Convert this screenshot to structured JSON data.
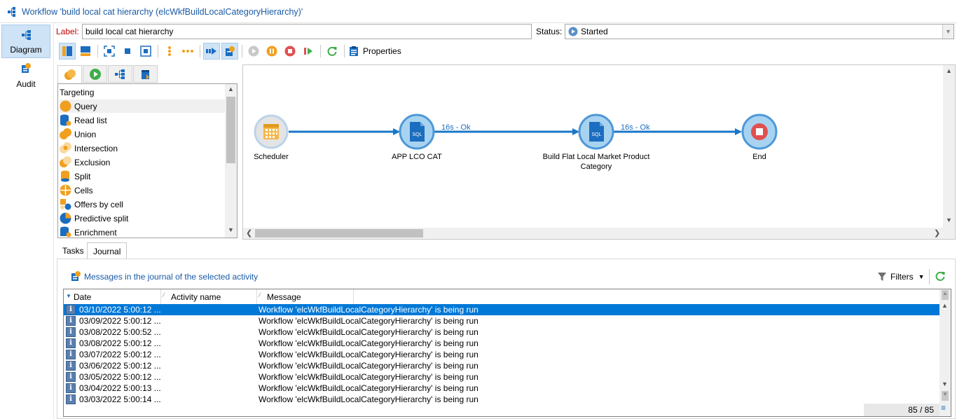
{
  "window": {
    "title": "Workflow 'build local cat  hierarchy (elcWkfBuildLocalCategoryHierarchy)'"
  },
  "nav": {
    "items": [
      {
        "label": "Diagram",
        "icon": "diagram-icon",
        "active": true
      },
      {
        "label": "Audit",
        "icon": "audit-icon",
        "active": false
      }
    ]
  },
  "form": {
    "label_caption": "Label:",
    "label_value": "build local cat  hierarchy",
    "status_caption": "Status:",
    "status_value": "Started"
  },
  "toolbar": {
    "properties_label": "Properties"
  },
  "palette": {
    "tabs": [
      "targeting-tab-icon",
      "flow-control-tab-icon",
      "actions-tab-icon",
      "events-tab-icon"
    ],
    "items": [
      {
        "label": "Targeting",
        "header": true
      },
      {
        "label": "Query",
        "icon": "query-icon"
      },
      {
        "label": "Read list",
        "icon": "read-list-icon"
      },
      {
        "label": "Union",
        "icon": "union-icon"
      },
      {
        "label": "Intersection",
        "icon": "intersection-icon"
      },
      {
        "label": "Exclusion",
        "icon": "exclusion-icon"
      },
      {
        "label": "Split",
        "icon": "split-icon"
      },
      {
        "label": "Cells",
        "icon": "cells-icon"
      },
      {
        "label": "Offers by cell",
        "icon": "offers-by-cell-icon"
      },
      {
        "label": "Predictive split",
        "icon": "predictive-split-icon"
      },
      {
        "label": "Enrichment",
        "icon": "enrichment-icon"
      }
    ]
  },
  "diagram": {
    "nodes": [
      {
        "label": "Scheduler",
        "icon": "calendar-icon"
      },
      {
        "label": "APP LCO CAT",
        "icon": "sql-icon"
      },
      {
        "label": "Build Flat Local Market Product Category",
        "icon": "sql-icon"
      },
      {
        "label": "End",
        "icon": "stop-icon"
      }
    ],
    "transitions": [
      {
        "label": ""
      },
      {
        "label": "16s - Ok"
      },
      {
        "label": "16s - Ok"
      }
    ]
  },
  "bottom_tabs": [
    "Tasks",
    "Journal"
  ],
  "journal": {
    "header_text": "Messages in the journal of the selected activity",
    "filters_label": "Filters",
    "columns": [
      "Date",
      "Activity name",
      "Message"
    ],
    "rows": [
      {
        "date": "03/10/2022 5:00:12 ...",
        "activity": "",
        "message": "Workflow 'elcWkfBuildLocalCategoryHierarchy' is being run"
      },
      {
        "date": "03/09/2022 5:00:12 ...",
        "activity": "",
        "message": "Workflow 'elcWkfBuildLocalCategoryHierarchy' is being run"
      },
      {
        "date": "03/08/2022 5:00:52 ...",
        "activity": "",
        "message": "Workflow 'elcWkfBuildLocalCategoryHierarchy' is being run"
      },
      {
        "date": "03/08/2022 5:00:12 ...",
        "activity": "",
        "message": "Workflow 'elcWkfBuildLocalCategoryHierarchy' is being run"
      },
      {
        "date": "03/07/2022 5:00:12 ...",
        "activity": "",
        "message": "Workflow 'elcWkfBuildLocalCategoryHierarchy' is being run"
      },
      {
        "date": "03/06/2022 5:00:12 ...",
        "activity": "",
        "message": "Workflow 'elcWkfBuildLocalCategoryHierarchy' is being run"
      },
      {
        "date": "03/05/2022 5:00:12 ...",
        "activity": "",
        "message": "Workflow 'elcWkfBuildLocalCategoryHierarchy' is being run"
      },
      {
        "date": "03/04/2022 5:00:13 ...",
        "activity": "",
        "message": "Workflow 'elcWkfBuildLocalCategoryHierarchy' is being run"
      },
      {
        "date": "03/03/2022 5:00:14 ...",
        "activity": "",
        "message": "Workflow 'elcWkfBuildLocalCategoryHierarchy' is being run"
      }
    ],
    "count": "85 / 85"
  },
  "colors": {
    "accent": "#1b6dbf",
    "selection": "#0078d7",
    "node_fill": "#a8d3f0",
    "link": "#1877c9"
  }
}
